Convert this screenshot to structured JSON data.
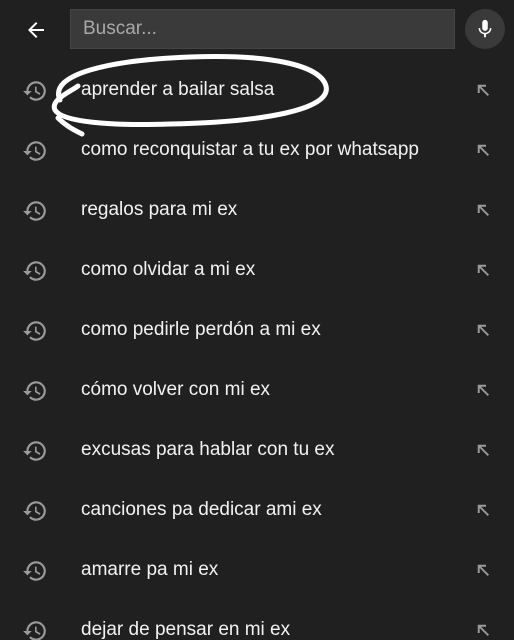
{
  "search": {
    "placeholder": "Buscar...",
    "value": ""
  },
  "icons": {
    "back": "arrow-left-icon",
    "mic": "microphone-icon",
    "history": "history-clock-icon",
    "fill": "arrow-up-left-icon"
  },
  "colors": {
    "background": "#202020",
    "search_bg": "#3a3a3a",
    "icon": "#9a9a9a",
    "text": "#f2f2f2",
    "annotation": "#ffffff"
  },
  "suggestions": [
    {
      "label": "aprender a bailar salsa"
    },
    {
      "label": "como reconquistar a tu ex por whatsapp"
    },
    {
      "label": "regalos para mi ex"
    },
    {
      "label": "como olvidar a mi ex"
    },
    {
      "label": "como pedirle perdón a mi ex"
    },
    {
      "label": "cómo volver con mi ex"
    },
    {
      "label": "excusas para hablar con tu ex"
    },
    {
      "label": "canciones pa dedicar ami ex"
    },
    {
      "label": "amarre pa mi ex"
    },
    {
      "label": "dejar de pensar en mi ex"
    }
  ]
}
